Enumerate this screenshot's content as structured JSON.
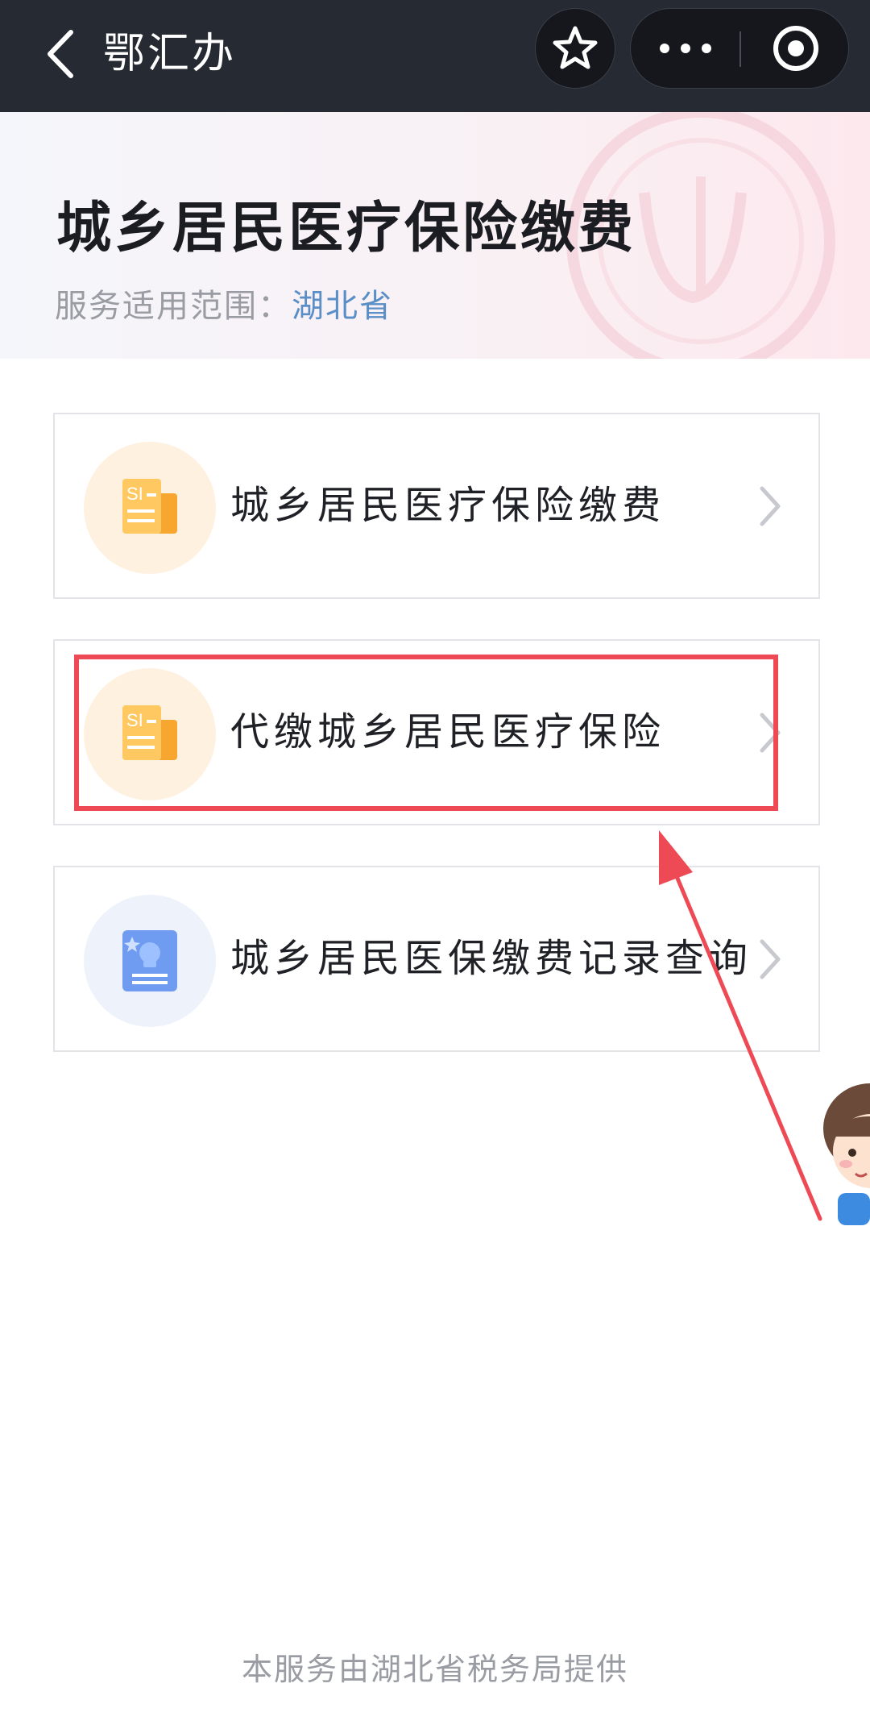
{
  "navbar": {
    "app_title": "鄂汇办",
    "back_icon": "chevron-left-icon",
    "favorite_icon": "star-icon",
    "more_icon": "more-dots-icon",
    "close_icon": "target-circle-icon"
  },
  "header": {
    "title": "城乡居民医疗保险缴费",
    "scope_label": "服务适用范围：",
    "scope_value": "湖北省"
  },
  "services": [
    {
      "label": "城乡居民医疗保险缴费",
      "icon": "si-document-icon",
      "icon_bg_color": "#fff1e0"
    },
    {
      "label": "代缴城乡居民医疗保险",
      "icon": "si-document-icon",
      "icon_bg_color": "#fff1e0"
    },
    {
      "label": "城乡居民医保缴费记录查询",
      "icon": "record-document-icon",
      "icon_bg_color": "#eef2fb"
    }
  ],
  "annotation": {
    "highlight_color": "#ee4a55",
    "highlighted_item": "代缴城乡居民医疗保险"
  },
  "footer": {
    "text": "本服务由湖北省税务局提供"
  },
  "colors": {
    "navbar_bg": "#262a33",
    "accent_blue": "#5a8ec6",
    "icon_orange": "#f7a72f"
  }
}
